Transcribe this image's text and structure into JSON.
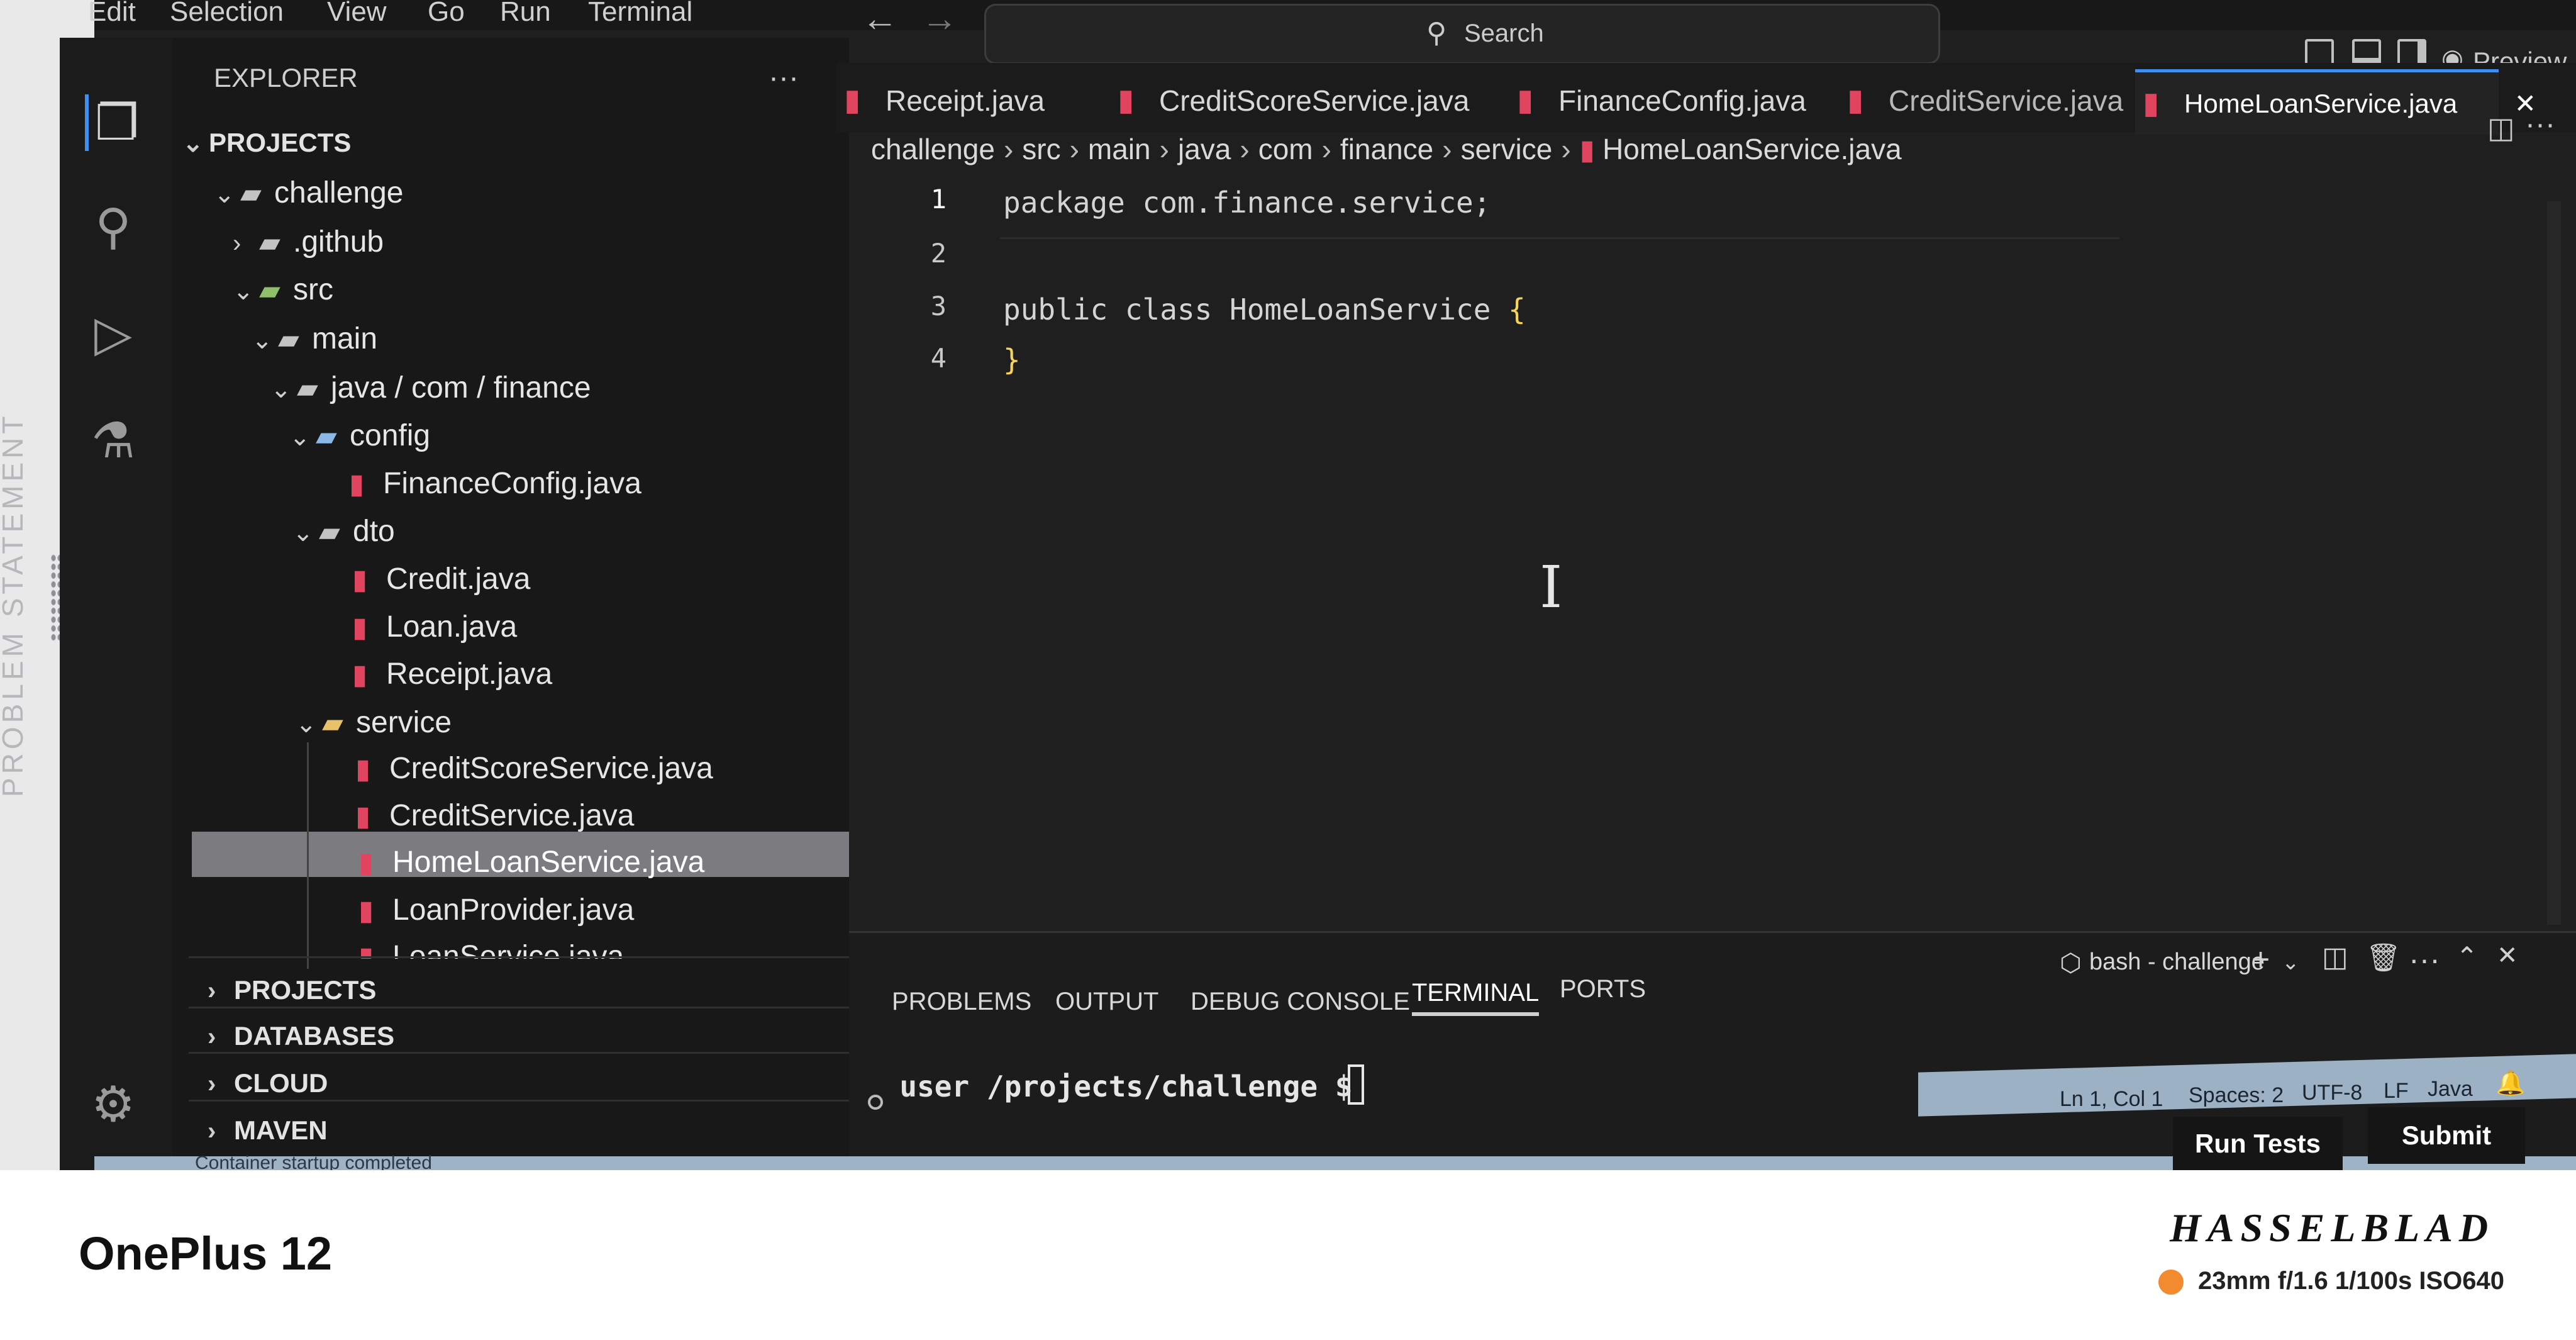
{
  "menu": [
    "Edit",
    "Selection",
    "View",
    "Go",
    "Run",
    "Terminal"
  ],
  "search": {
    "label": "Search"
  },
  "title_bar": {
    "preview_label": "Preview"
  },
  "sidebar": {
    "title": "EXPLORER",
    "more": "···",
    "root_section": "PROJECTS",
    "tree": [
      {
        "label": "challenge",
        "type": "folder",
        "expanded": true
      },
      {
        "label": ".github",
        "type": "folder",
        "expanded": false
      },
      {
        "label": "src",
        "type": "folder",
        "expanded": true
      },
      {
        "label": "main",
        "type": "folder",
        "expanded": true
      },
      {
        "label": "java / com / finance",
        "type": "folder",
        "expanded": true
      },
      {
        "label": "config",
        "type": "folder",
        "expanded": true
      },
      {
        "label": "FinanceConfig.java",
        "type": "java"
      },
      {
        "label": "dto",
        "type": "folder",
        "expanded": true
      },
      {
        "label": "Credit.java",
        "type": "java"
      },
      {
        "label": "Loan.java",
        "type": "java"
      },
      {
        "label": "Receipt.java",
        "type": "java"
      },
      {
        "label": "service",
        "type": "folder",
        "expanded": true
      },
      {
        "label": "CreditScoreService.java",
        "type": "java"
      },
      {
        "label": "CreditService.java",
        "type": "java"
      },
      {
        "label": "HomeLoanService.java",
        "type": "java",
        "selected": true
      },
      {
        "label": "LoanProvider.java",
        "type": "java"
      },
      {
        "label": "LoanService.java",
        "type": "java"
      }
    ],
    "sections": [
      "PROJECTS",
      "DATABASES",
      "CLOUD",
      "MAVEN"
    ]
  },
  "tabs": [
    {
      "label": "Receipt.java",
      "active": false
    },
    {
      "label": "CreditScoreService.java",
      "active": false
    },
    {
      "label": "FinanceConfig.java",
      "active": false
    },
    {
      "label": "CreditService.java",
      "active": false
    },
    {
      "label": "HomeLoanService.java",
      "active": true
    }
  ],
  "breadcrumb": [
    "challenge",
    "src",
    "main",
    "java",
    "com",
    "finance",
    "service",
    "HomeLoanService.java"
  ],
  "editor": {
    "lines": [
      {
        "no": "1",
        "code": "package com.finance.service;"
      },
      {
        "no": "2",
        "code": ""
      },
      {
        "no": "3",
        "code": "public class HomeLoanService "
      },
      {
        "no": "4",
        "code": ""
      }
    ],
    "open_brace": "{",
    "close_brace": "}"
  },
  "panel": {
    "tabs": [
      "PROBLEMS",
      "OUTPUT",
      "DEBUG CONSOLE",
      "TERMINAL",
      "PORTS"
    ],
    "active_tab": "TERMINAL",
    "shell_label": "bash - challenge",
    "terminal": {
      "user": "user",
      "path": "/projects/challenge",
      "prompt": "$"
    }
  },
  "status": {
    "position": "Ln 1, Col 1",
    "spaces": "Spaces: 2",
    "encoding": "UTF-8",
    "eol": "LF",
    "language": "Java",
    "bottom_text": "Container startup completed"
  },
  "actions": {
    "run_tests": "Run Tests",
    "submit": "Submit"
  },
  "side_tab": {
    "label": "PROBLEM STATEMENT"
  },
  "watermark": {
    "device": "OnePlus 12",
    "brand": "HASSELBLAD",
    "shot": "23mm  f/1.6  1/100s  ISO640",
    "dot_color": "#f28a30"
  },
  "colors": {
    "accent": "#3f8ef0",
    "java_icon": "#e0445e",
    "status_bar": "#9db1c5"
  }
}
